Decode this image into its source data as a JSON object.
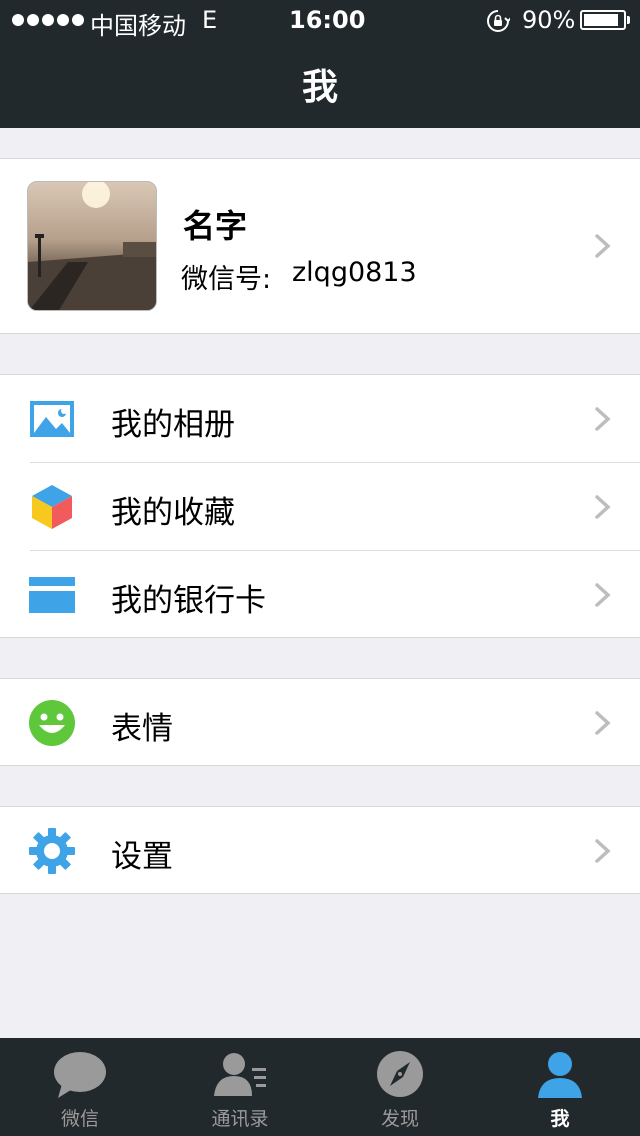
{
  "status_bar": {
    "carrier": "中国移动",
    "network": "E",
    "time": "16:00",
    "battery_percent": "90%",
    "battery_level": 0.9
  },
  "header": {
    "title": "我"
  },
  "profile": {
    "name": "名字",
    "wechat_id_label": "微信号:",
    "wechat_id": "zlqg0813"
  },
  "menu": {
    "album": "我的相册",
    "favorites": "我的收藏",
    "bank_card": "我的银行卡",
    "stickers": "表情",
    "settings": "设置"
  },
  "tabs": [
    {
      "label": "微信",
      "icon": "chat-bubble-icon"
    },
    {
      "label": "通讯录",
      "icon": "contacts-icon"
    },
    {
      "label": "发现",
      "icon": "compass-icon"
    },
    {
      "label": "我",
      "icon": "person-icon"
    }
  ],
  "colors": {
    "bar_bg": "#22292c",
    "page_bg": "#efeff4",
    "accent_blue": "#3fa3e8",
    "green": "#5ec73a",
    "tab_inactive": "#9a9a9a"
  }
}
